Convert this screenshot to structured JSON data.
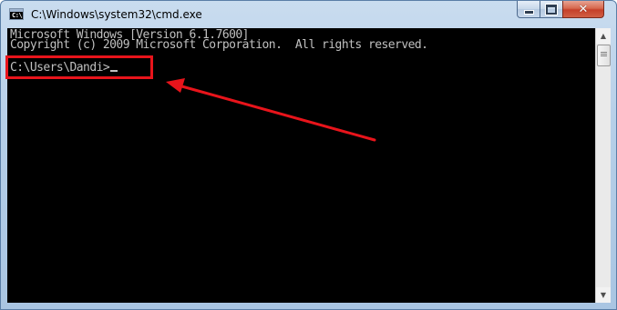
{
  "window": {
    "title": "C:\\Windows\\system32\\cmd.exe",
    "icon_label": "C:\\"
  },
  "controls": {
    "minimize_icon": "minimize-icon",
    "maximize_icon": "maximize-icon",
    "close_icon": "close-icon",
    "close_glyph": "✕"
  },
  "console": {
    "lines": [
      "Microsoft Windows [Version 6.1.7600]",
      "Copyright (c) 2009 Microsoft Corporation.  All rights reserved."
    ],
    "prompt": "C:\\Users\\Dandi>"
  },
  "scrollbar": {
    "up_glyph": "▲",
    "down_glyph": "▼"
  },
  "annotation": {
    "box_color": "#e8141b",
    "arrow_color": "#e8141b"
  }
}
